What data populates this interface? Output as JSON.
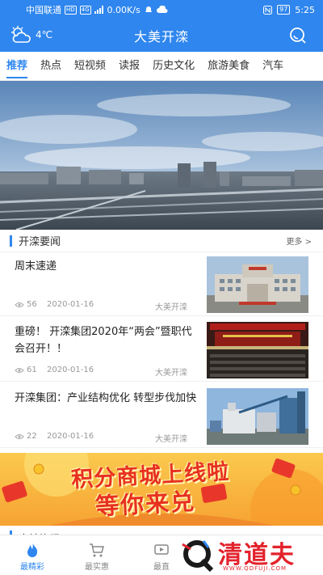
{
  "status_bar": {
    "carrier": "中国联通",
    "badge_hd": "HD",
    "badge_4g": "4G",
    "speed": "0.00K/s",
    "battery": "97",
    "time": "5:25"
  },
  "header": {
    "temperature": "4℃",
    "title": "大美开滦",
    "weather_icon": "partly-cloudy-icon",
    "search_icon": "search-icon"
  },
  "tabs": [
    {
      "label": "推荐",
      "active": true
    },
    {
      "label": "热点"
    },
    {
      "label": "短视频"
    },
    {
      "label": "读报"
    },
    {
      "label": "历史文化"
    },
    {
      "label": "旅游美食"
    },
    {
      "label": "汽车"
    }
  ],
  "section": {
    "title": "开滦要闻",
    "more": "更多 >"
  },
  "news": [
    {
      "title": "周末速递",
      "views": "56",
      "date": "2020-01-16",
      "source": "大美开滦"
    },
    {
      "title": "重磅！ 开滦集团2020年“两会”暨职代会召开！！",
      "views": "61",
      "date": "2020-01-16",
      "source": "大美开滦"
    },
    {
      "title": "开滦集团：产业结构优化 转型步伐加快",
      "views": "22",
      "date": "2020-01-16",
      "source": "大美开滦"
    }
  ],
  "ad": {
    "line1": "积分商城上线啦",
    "line2": "等你来兑"
  },
  "section2": {
    "title": "本地资讯"
  },
  "bottom_nav": [
    {
      "label": "最精彩",
      "icon": "flame-icon",
      "active": true
    },
    {
      "label": "最实惠",
      "icon": "cart-icon"
    },
    {
      "label": "最直",
      "icon": "tv-icon"
    }
  ],
  "watermark": {
    "text": "清道夫",
    "url": "WWW.QDFUJI.COM"
  },
  "colors": {
    "brand_blue": "#2f86ee",
    "watermark_red": "#e3232c"
  }
}
